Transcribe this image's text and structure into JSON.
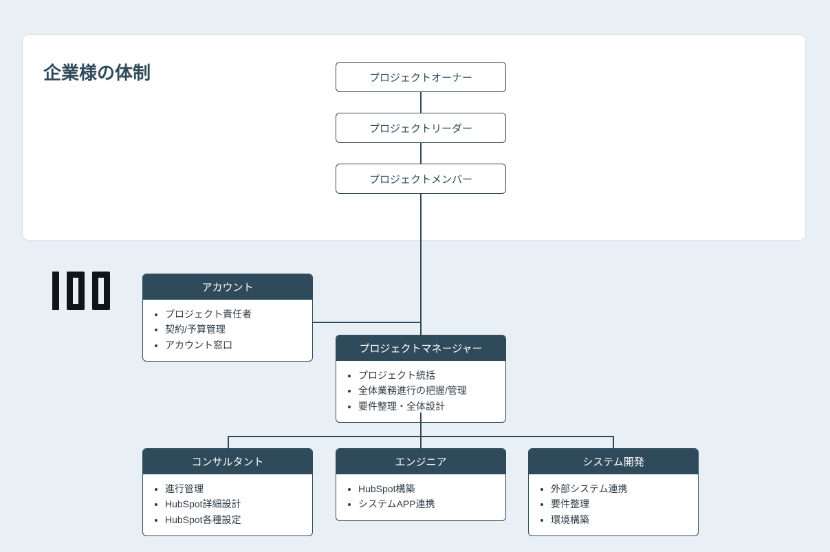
{
  "client": {
    "title": "企業様の体制",
    "owner": "プロジェクトオーナー",
    "leader": "プロジェクトリーダー",
    "member": "プロジェクトメンバー"
  },
  "vendor": {
    "logo_label": "100",
    "account": {
      "title": "アカウント",
      "items": [
        "プロジェクト責任者",
        "契約/予算管理",
        "アカウント窓口"
      ]
    },
    "pm": {
      "title": "プロジェクトマネージャー",
      "items": [
        "プロジェクト統括",
        "全体業務進行の把握/管理",
        "要件整理・全体設計"
      ]
    },
    "consultant": {
      "title": "コンサルタント",
      "items": [
        "進行管理",
        "HubSpot詳細設計",
        "HubSpot各種設定"
      ]
    },
    "engineer": {
      "title": "エンジニア",
      "items": [
        "HubSpot構築",
        "システムAPP連携"
      ]
    },
    "sysdev": {
      "title": "システム開発",
      "items": [
        "外部システム連携",
        "要件整理",
        "環境構築"
      ]
    }
  },
  "colors": {
    "bg": "#e8f0f5",
    "panel_bg": "#ffffff",
    "accent_dark": "#2f4a5a",
    "text": "#2f3b45"
  }
}
